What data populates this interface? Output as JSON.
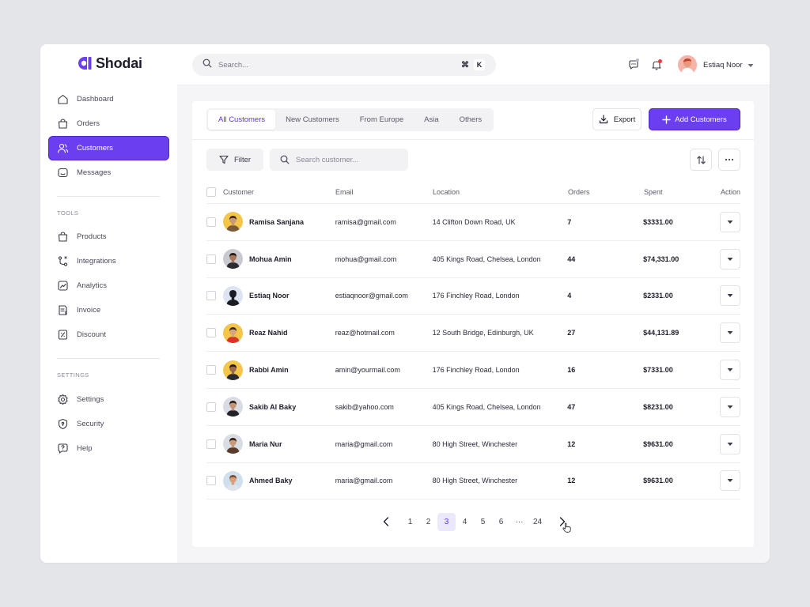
{
  "brand": {
    "name": "Shodai",
    "accent": "#6b3ff0"
  },
  "sidebar": {
    "main_items": [
      {
        "label": "Dashboard",
        "icon": "home-icon"
      },
      {
        "label": "Orders",
        "icon": "bag-icon"
      },
      {
        "label": "Customers",
        "icon": "users-icon",
        "active": true
      },
      {
        "label": "Messages",
        "icon": "message-icon"
      }
    ],
    "tools_label": "TOOLS",
    "tools_items": [
      {
        "label": "Products",
        "icon": "box-icon"
      },
      {
        "label": "Integrations",
        "icon": "integrations-icon"
      },
      {
        "label": "Analytics",
        "icon": "analytics-icon"
      },
      {
        "label": "Invoice",
        "icon": "invoice-icon"
      },
      {
        "label": "Discount",
        "icon": "discount-icon"
      }
    ],
    "settings_label": "SETTINGS",
    "settings_items": [
      {
        "label": "Settings",
        "icon": "gear-icon"
      },
      {
        "label": "Security",
        "icon": "shield-icon"
      },
      {
        "label": "Help",
        "icon": "help-icon"
      }
    ]
  },
  "header": {
    "search_placeholder": "Search...",
    "shortcut_symbol": "⌘",
    "shortcut_key": "K",
    "user_name": "Estiaq Noor"
  },
  "tabs": [
    "All Customers",
    "New Customers",
    "From Europe",
    "Asia",
    "Others"
  ],
  "toolbar": {
    "export_label": "Export",
    "add_label": "Add Customers",
    "filter_label": "Filter",
    "search_placeholder": "Search customer..."
  },
  "table": {
    "columns": [
      "Customer",
      "Email",
      "Location",
      "Orders",
      "Spent",
      "Action"
    ],
    "rows": [
      {
        "name": "Ramisa Sanjana",
        "email": "ramisa@gmail.com",
        "location": "14 Clifton Down Road, UK",
        "orders": "7",
        "spent": "$3331.00",
        "avatar_bg": "#f3c64a",
        "shirt": "#7a5a3a",
        "skin": "#c89a74",
        "hair": "#3a2418"
      },
      {
        "name": "Mohua Amin",
        "email": "mohua@gmail.com",
        "location": "405 Kings Road, Chelsea, London",
        "orders": "44",
        "spent": "$74,331.00",
        "avatar_bg": "#c9c9cf",
        "shirt": "#2b2b30",
        "skin": "#a8775a",
        "hair": "#1e1410"
      },
      {
        "name": "Estiaq Noor",
        "email": "estiaqnoor@gmail.com",
        "location": "176 Finchley Road, London",
        "orders": "4",
        "spent": "$2331.00",
        "avatar_bg": "#dde3f0",
        "shirt": "#1b1b24",
        "skin": "#1b1b24",
        "hair": "#1b1b24"
      },
      {
        "name": "Reaz Nahid",
        "email": "reaz@hotmail.com",
        "location": "12 South Bridge, Edinburgh, UK",
        "orders": "27",
        "spent": "$44,131.89",
        "avatar_bg": "#f3c64a",
        "shirt": "#d8342a",
        "skin": "#d8a47e",
        "hair": "#3a2418"
      },
      {
        "name": "Rabbi Amin",
        "email": "amin@yourmail.com",
        "location": "176 Finchley Road, London",
        "orders": "16",
        "spent": "$7331.00",
        "avatar_bg": "#f3c64a",
        "shirt": "#2a2a30",
        "skin": "#9a6a4a",
        "hair": "#1e1410"
      },
      {
        "name": "Sakib Al Baky",
        "email": "sakib@yahoo.com",
        "location": "405 Kings Road, Chelsea, London",
        "orders": "47",
        "spent": "$8231.00",
        "avatar_bg": "#d9dce3",
        "shirt": "#222228",
        "skin": "#c69474",
        "hair": "#2a1c14"
      },
      {
        "name": "Maria Nur",
        "email": "maria@gmail.com",
        "location": "80 High Street, Winchester",
        "orders": "12",
        "spent": "$9631.00",
        "avatar_bg": "#d9dce3",
        "shirt": "#5a3a2a",
        "skin": "#c89a78",
        "hair": "#2e1c12"
      },
      {
        "name": "Ahmed Baky",
        "email": "maria@gmail.com",
        "location": "80 High Street, Winchester",
        "orders": "12",
        "spent": "$9631.00",
        "avatar_bg": "#cfe0ec",
        "shirt": "#e0e4ea",
        "skin": "#d8a07a",
        "hair": "#7a4a28"
      }
    ]
  },
  "pagination": {
    "pages": [
      "1",
      "2",
      "3",
      "4",
      "5",
      "6",
      "···",
      "24"
    ],
    "current": "3"
  }
}
